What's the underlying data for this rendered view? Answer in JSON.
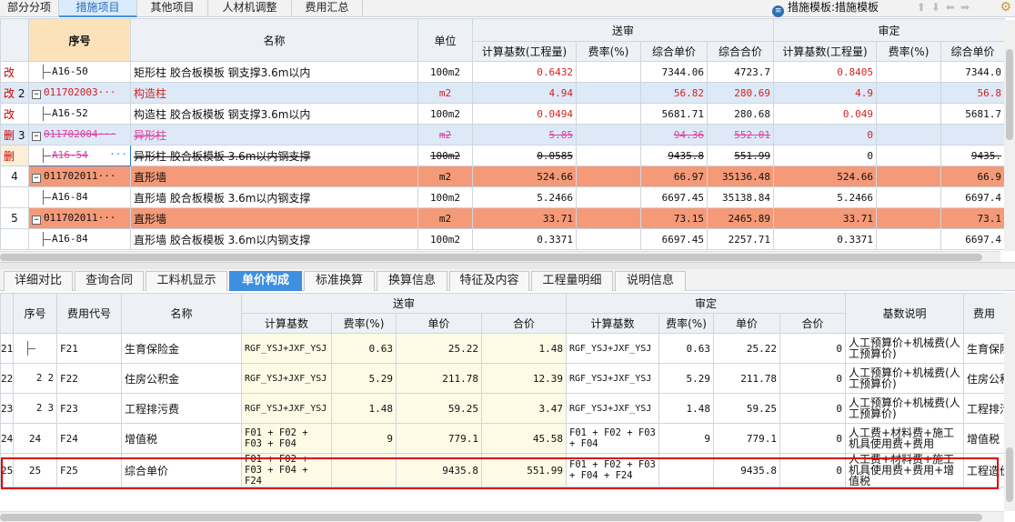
{
  "top_tabs": [
    "部分分项",
    "措施项目",
    "其他项目",
    "人材机调整",
    "费用汇总"
  ],
  "template_label": "措施模板:措施模板",
  "upper": {
    "headers": {
      "seq": "序号",
      "name": "名称",
      "unit": "单位",
      "group_a": "送审",
      "group_b": "审定",
      "base": "计算基数(工程量)",
      "rate": "费率(%)",
      "price": "综合单价",
      "total": "综合合价",
      "base_b": "计算基数(工程量)",
      "rate_b": "费率(%)",
      "price_b": "综合单价"
    },
    "rows": [
      {
        "tag": "改",
        "seq": "",
        "code": "A16-50",
        "name": "矩形柱 胶合板模板 钢支撑3.6m以内",
        "unit": "100m2",
        "base": "0.6432",
        "rate": "",
        "price": "7344.06",
        "total": "4723.7",
        "base_b": "0.8405",
        "rate_b": "",
        "price_b": "7344.0"
      },
      {
        "tag": "改",
        "seq": "2",
        "code": "011702003···",
        "name": "构造柱",
        "unit": "m2",
        "base": "4.94",
        "rate": "",
        "price": "56.82",
        "total": "280.69",
        "base_b": "4.9",
        "rate_b": "",
        "price_b": "56.8"
      },
      {
        "tag": "改",
        "seq": "",
        "code": "A16-52",
        "name": "构造柱 胶合板模板 钢支撑3.6m以内",
        "unit": "100m2",
        "base": "0.0494",
        "rate": "",
        "price": "5681.71",
        "total": "280.68",
        "base_b": "0.049",
        "rate_b": "",
        "price_b": "5681.7"
      },
      {
        "tag": "删",
        "seq": "3",
        "code": "011702004···",
        "name": "异形柱",
        "unit": "m2",
        "base": "5.85",
        "rate": "",
        "price": "94.36",
        "total": "552.01",
        "base_b": "0",
        "rate_b": "",
        "price_b": ""
      },
      {
        "tag": "删",
        "seq": "",
        "code": "A16-54",
        "name": "异形柱 胶合板模板 3.6m以内钢支撑",
        "unit": "100m2",
        "base": "0.0585",
        "rate": "",
        "price": "9435.8",
        "total": "551.99",
        "base_b": "0",
        "rate_b": "",
        "price_b": "9435."
      },
      {
        "tag": "",
        "seq": "4",
        "code": "011702011···",
        "name": "直形墙",
        "unit": "m2",
        "base": "524.66",
        "rate": "",
        "price": "66.97",
        "total": "35136.48",
        "base_b": "524.66",
        "rate_b": "",
        "price_b": "66.9"
      },
      {
        "tag": "",
        "seq": "",
        "code": "A16-84",
        "name": "直形墙 胶合板模板 3.6m以内钢支撑",
        "unit": "100m2",
        "base": "5.2466",
        "rate": "",
        "price": "6697.45",
        "total": "35138.84",
        "base_b": "5.2466",
        "rate_b": "",
        "price_b": "6697.4"
      },
      {
        "tag": "",
        "seq": "5",
        "code": "011702011···",
        "name": "直形墙",
        "unit": "m2",
        "base": "33.71",
        "rate": "",
        "price": "73.15",
        "total": "2465.89",
        "base_b": "33.71",
        "rate_b": "",
        "price_b": "73.1"
      },
      {
        "tag": "",
        "seq": "",
        "code": "A16-84",
        "name": "直形墙 胶合板模板 3.6m以内钢支撑",
        "unit": "100m2",
        "base": "0.3371",
        "rate": "",
        "price": "6697.45",
        "total": "2257.71",
        "base_b": "0.3371",
        "rate_b": "",
        "price_b": "6697.4"
      }
    ]
  },
  "bottom_tabs": [
    "详细对比",
    "查询合同",
    "工料机显示",
    "单价构成",
    "标准换算",
    "换算信息",
    "特征及内容",
    "工程量明细",
    "说明信息"
  ],
  "lower": {
    "headers": {
      "seq": "序号",
      "code": "费用代号",
      "name": "名称",
      "group_a": "送审",
      "group_b": "审定",
      "base": "计算基数",
      "rate": "费率(%)",
      "unit_price": "单价",
      "total": "合价",
      "base_b": "计算基数",
      "rate_b": "费率(%)",
      "unit_price_b": "单价",
      "total_b": "合价",
      "desc": "基数说明",
      "fee": "费用"
    },
    "rows": [
      {
        "idx": "21",
        "seq": "",
        "code": "F21",
        "name": "生育保险金",
        "base": "RGF_YSJ+JXF_YSJ",
        "rate": "0.63",
        "unit_price": "25.22",
        "total": "1.48",
        "base_b": "RGF_YSJ+JXF_YSJ",
        "rate_b": "0.63",
        "unit_price_b": "25.22",
        "total_b": "0",
        "desc": "人工预算价+机械费(人工预算价)",
        "fee": "生育保险"
      },
      {
        "idx": "22",
        "seq": "2 2",
        "code": "F22",
        "name": "住房公积金",
        "base": "RGF_YSJ+JXF_YSJ",
        "rate": "5.29",
        "unit_price": "211.78",
        "total": "12.39",
        "base_b": "RGF_YSJ+JXF_YSJ",
        "rate_b": "5.29",
        "unit_price_b": "211.78",
        "total_b": "0",
        "desc": "人工预算价+机械费(人工预算价)",
        "fee": "住房公积"
      },
      {
        "idx": "23",
        "seq": "2 3",
        "code": "F23",
        "name": "工程排污费",
        "base": "RGF_YSJ+JXF_YSJ",
        "rate": "1.48",
        "unit_price": "59.25",
        "total": "3.47",
        "base_b": "RGF_YSJ+JXF_YSJ",
        "rate_b": "1.48",
        "unit_price_b": "59.25",
        "total_b": "0",
        "desc": "人工预算价+机械费(人工预算价)",
        "fee": "工程排污"
      },
      {
        "idx": "24",
        "seq": "24",
        "code": "F24",
        "name": "增值税",
        "base": "F01 + F02 + F03 + F04",
        "rate": "9",
        "unit_price": "779.1",
        "total": "45.58",
        "base_b": "F01 + F02 + F03 + F04",
        "rate_b": "9",
        "unit_price_b": "779.1",
        "total_b": "0",
        "desc": "人工费+材料费+施工机具使用费+费用",
        "fee": "增值税"
      },
      {
        "idx": "25",
        "seq": "25",
        "code": "F25",
        "name": "综合单价",
        "base": "F01 + F02 + F03 + F04 + F24",
        "rate": "",
        "unit_price": "9435.8",
        "total": "551.99",
        "base_b": "F01 + F02 + F03 + F04 + F24",
        "rate_b": "",
        "unit_price_b": "9435.8",
        "total_b": "0",
        "desc": "人工费+材料费+施工机具使用费+费用+增值税",
        "fee": "工程造价"
      }
    ]
  }
}
